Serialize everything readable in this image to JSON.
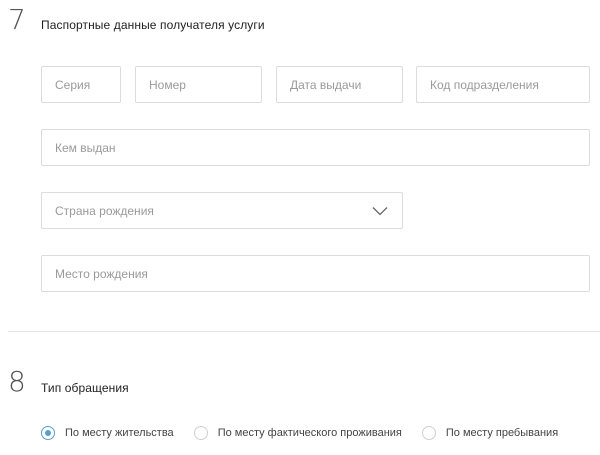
{
  "passport_section": {
    "number": "7",
    "title": "Паспортные данные получателя услуги",
    "series_placeholder": "Серия",
    "number_placeholder": "Номер",
    "issue_date_placeholder": "Дата выдачи",
    "division_code_placeholder": "Код подразделения",
    "issued_by_placeholder": "Кем выдан",
    "birth_country": {
      "placeholder": "Страна рождения",
      "icon": "chevron-down-icon"
    },
    "birth_place_placeholder": "Место рождения"
  },
  "request_type_section": {
    "number": "8",
    "title": "Тип обращения",
    "options": [
      {
        "label": "По месту жительства",
        "checked": true
      },
      {
        "label": "По месту фактического проживания",
        "checked": false
      },
      {
        "label": "По месту пребывания",
        "checked": false
      }
    ]
  },
  "colors": {
    "accent": "#5b9ec9",
    "border": "#dcdcdc",
    "placeholder": "#9a9a9a"
  }
}
